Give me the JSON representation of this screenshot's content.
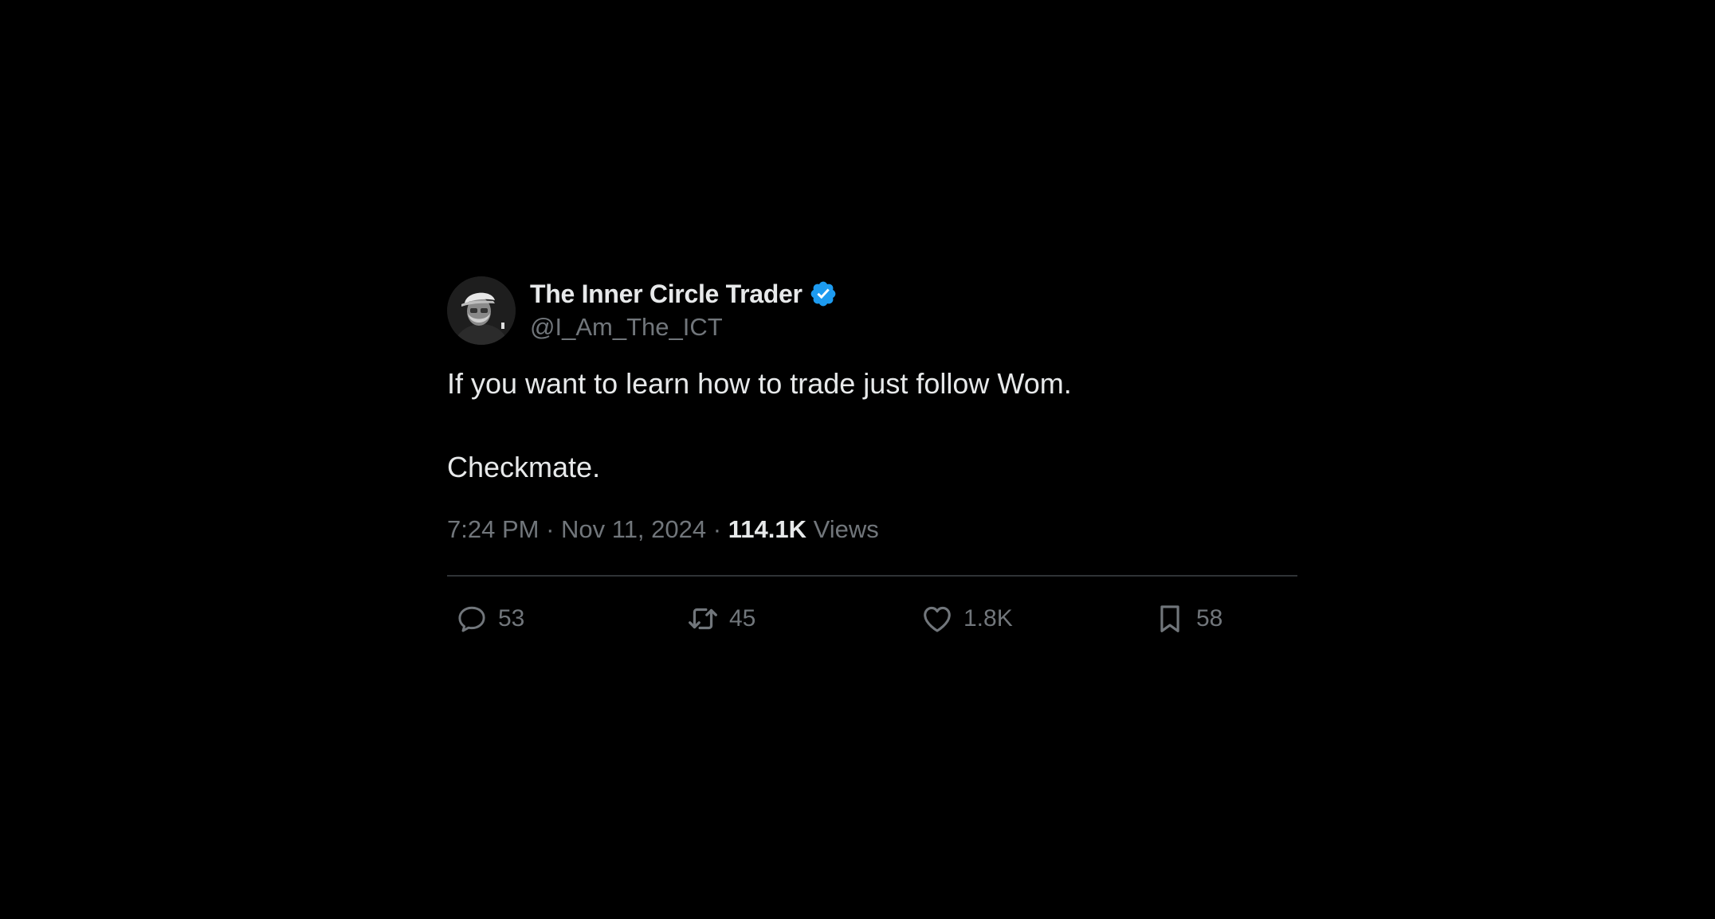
{
  "tweet": {
    "author": {
      "display_name": "The Inner Circle Trader",
      "handle": "@I_Am_The_ICT",
      "verified": true,
      "verified_color": "#1d9bf0"
    },
    "text": {
      "line1": "If you want to learn how to trade just follow Wom.",
      "line2": "Checkmate."
    },
    "meta": {
      "time": "7:24 PM",
      "separator": "·",
      "date": "Nov 11, 2024",
      "views_count": "114.1K",
      "views_label": "Views"
    },
    "actions": {
      "replies": "53",
      "retweets": "45",
      "likes": "1.8K",
      "bookmarks": "58"
    }
  },
  "colors": {
    "background": "#000000",
    "primary_text": "#e7e9ea",
    "secondary_text": "#71767b",
    "divider": "#2f3336"
  }
}
